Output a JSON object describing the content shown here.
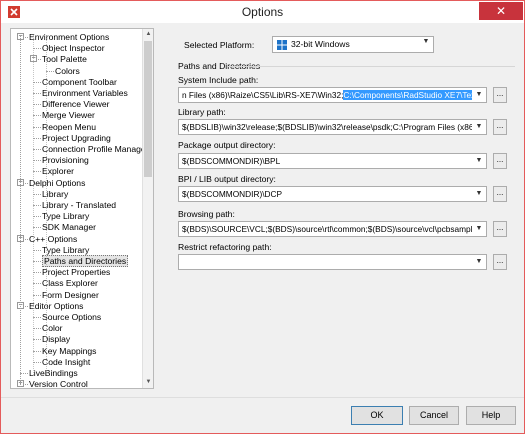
{
  "window": {
    "title": "Options",
    "close_glyph": "✕"
  },
  "tree": [
    {
      "label": "Environment Options",
      "toggle": "−"
    },
    {
      "label": "Object Inspector"
    },
    {
      "label": "Tool Palette",
      "toggle": "−"
    },
    {
      "label": "Colors"
    },
    {
      "label": "Component Toolbar"
    },
    {
      "label": "Environment Variables"
    },
    {
      "label": "Difference Viewer"
    },
    {
      "label": "Merge Viewer"
    },
    {
      "label": "Reopen Menu"
    },
    {
      "label": "Project Upgrading"
    },
    {
      "label": "Connection Profile Manager"
    },
    {
      "label": "Provisioning"
    },
    {
      "label": "Explorer"
    },
    {
      "label": "Delphi Options",
      "toggle": "−"
    },
    {
      "label": "Library"
    },
    {
      "label": "Library - Translated"
    },
    {
      "label": "Type Library"
    },
    {
      "label": "SDK Manager"
    },
    {
      "label": "C++ Options",
      "toggle": "−"
    },
    {
      "label": "Type Library"
    },
    {
      "label": "Paths and Directories",
      "selected": true
    },
    {
      "label": "Project Properties"
    },
    {
      "label": "Class Explorer"
    },
    {
      "label": "Form Designer"
    },
    {
      "label": "Editor Options",
      "toggle": "−"
    },
    {
      "label": "Source Options"
    },
    {
      "label": "Color"
    },
    {
      "label": "Display"
    },
    {
      "label": "Key Mappings"
    },
    {
      "label": "Code Insight"
    },
    {
      "label": "LiveBindings"
    },
    {
      "label": "Version Control",
      "toggle": "+"
    }
  ],
  "platform": {
    "label": "Selected Platform:",
    "value": "32-bit Windows"
  },
  "group_title": "Paths and Directories",
  "fields": {
    "system_include": {
      "label": "System Include path:",
      "value_plain": "n Files (x86)\\Raize\\CS5\\Lib\\RS-XE7\\Win32;",
      "value_selected": "C:\\Components\\RadStudio XE7\\TextControl"
    },
    "library": {
      "label": "Library path:",
      "value": "$(BDSLIB)\\win32\\release;$(BDSLIB)\\win32\\release\\psdk;C:\\Program Files (x86)\\FastRe"
    },
    "package_output": {
      "label": "Package output directory:",
      "value": "$(BDSCOMMONDIR)\\BPL"
    },
    "bpi_lib_output": {
      "label": "BPI / LIB output directory:",
      "value": "$(BDSCOMMONDIR)\\DCP"
    },
    "browsing": {
      "label": "Browsing path:",
      "value": "$(BDS)\\SOURCE\\VCL;$(BDS)\\source\\rtl\\common;$(BDS)\\source\\vcl\\pcbsamples;$(BDS)\\source\\vcl\\jpg\\src;$(BDS)"
    },
    "restrict_refactoring": {
      "label": "Restrict refactoring path:",
      "value": ""
    }
  },
  "ellipsis": "...",
  "buttons": {
    "ok": "OK",
    "cancel": "Cancel",
    "help": "Help"
  },
  "colors": {
    "accent": "#c8333c",
    "selection": "#3399ff"
  }
}
